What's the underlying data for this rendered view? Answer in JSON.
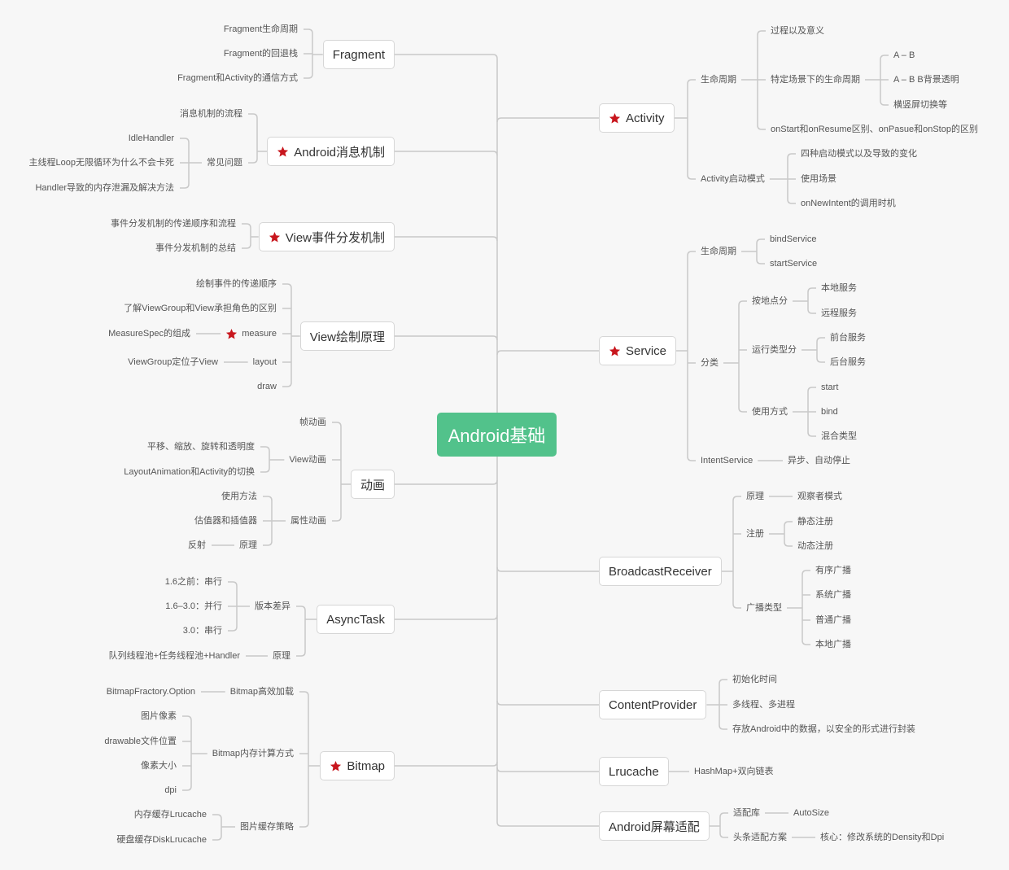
{
  "theme": {
    "background": "#f7f7f7",
    "root_fill": "#52c28b",
    "root_text": "#ffffff",
    "node_border": "#d6d6d6",
    "line": "#c9c9c9",
    "star": "#c8161d",
    "text": "#555555"
  },
  "root": {
    "label": "Android基础"
  },
  "left": [
    {
      "label": "Fragment",
      "starred": false,
      "children": [
        {
          "label": "Fragment生命周期"
        },
        {
          "label": "Fragment的回退栈"
        },
        {
          "label": "Fragment和Activity的通信方式"
        }
      ]
    },
    {
      "label": "Android消息机制",
      "starred": true,
      "children": [
        {
          "label": "消息机制的流程"
        },
        {
          "label": "常见问题",
          "children": [
            {
              "label": "IdleHandler"
            },
            {
              "label": "主线程Loop无限循环为什么不会卡死"
            },
            {
              "label": "Handler导致的内存泄漏及解决方法"
            }
          ]
        }
      ]
    },
    {
      "label": "View事件分发机制",
      "starred": true,
      "children": [
        {
          "label": "事件分发机制的传递顺序和流程"
        },
        {
          "label": "事件分发机制的总结"
        }
      ]
    },
    {
      "label": "View绘制原理",
      "starred": false,
      "children": [
        {
          "label": "绘制事件的传递顺序"
        },
        {
          "label": "了解ViewGroup和View承担角色的区别"
        },
        {
          "label": "measure",
          "starred": true,
          "children": [
            {
              "label": "MeasureSpec的组成"
            }
          ]
        },
        {
          "label": "layout",
          "children": [
            {
              "label": "ViewGroup定位子View"
            }
          ]
        },
        {
          "label": "draw"
        }
      ]
    },
    {
      "label": "动画",
      "starred": false,
      "children": [
        {
          "label": "帧动画"
        },
        {
          "label": "View动画",
          "children": [
            {
              "label": "平移、缩放、旋转和透明度"
            },
            {
              "label": "LayoutAnimation和Activity的切换"
            }
          ]
        },
        {
          "label": "属性动画",
          "children": [
            {
              "label": "使用方法"
            },
            {
              "label": "估值器和插值器"
            },
            {
              "label": "原理",
              "children": [
                {
                  "label": "反射"
                }
              ]
            }
          ]
        }
      ]
    },
    {
      "label": "AsyncTask",
      "starred": false,
      "children": [
        {
          "label": "版本差异",
          "children": [
            {
              "label": "1.6之前：串行"
            },
            {
              "label": "1.6–3.0：并行"
            },
            {
              "label": "3.0：串行"
            }
          ]
        },
        {
          "label": "原理",
          "children": [
            {
              "label": "队列线程池+任务线程池+Handler"
            }
          ]
        }
      ]
    },
    {
      "label": "Bitmap",
      "starred": true,
      "children": [
        {
          "label": "Bitmap高效加载",
          "children": [
            {
              "label": "BitmapFractory.Option"
            }
          ]
        },
        {
          "label": "Bitmap内存计算方式",
          "children": [
            {
              "label": "图片像素"
            },
            {
              "label": "drawable文件位置"
            },
            {
              "label": "像素大小"
            },
            {
              "label": "dpi"
            }
          ]
        },
        {
          "label": "图片缓存策略",
          "children": [
            {
              "label": "内存缓存Lrucache"
            },
            {
              "label": "硬盘缓存DiskLrucache"
            }
          ]
        }
      ]
    }
  ],
  "right": [
    {
      "label": "Activity",
      "starred": true,
      "children": [
        {
          "label": "生命周期",
          "children": [
            {
              "label": "过程以及意义"
            },
            {
              "label": "特定场景下的生命周期",
              "children": [
                {
                  "label": "A – B"
                },
                {
                  "label": "A – B B背景透明"
                },
                {
                  "label": "横竖屏切换等"
                }
              ]
            },
            {
              "label": "onStart和onResume区别、onPasue和onStop的区别"
            }
          ]
        },
        {
          "label": "Activity启动模式",
          "children": [
            {
              "label": "四种启动模式以及导致的变化"
            },
            {
              "label": "使用场景"
            },
            {
              "label": "onNewIntent的调用时机"
            }
          ]
        }
      ]
    },
    {
      "label": "Service",
      "starred": true,
      "children": [
        {
          "label": "生命周期",
          "children": [
            {
              "label": "bindService"
            },
            {
              "label": "startService"
            }
          ]
        },
        {
          "label": "分类",
          "children": [
            {
              "label": "按地点分",
              "children": [
                {
                  "label": "本地服务"
                },
                {
                  "label": "远程服务"
                }
              ]
            },
            {
              "label": "运行类型分",
              "children": [
                {
                  "label": "前台服务"
                },
                {
                  "label": "后台服务"
                }
              ]
            },
            {
              "label": "使用方式",
              "children": [
                {
                  "label": "start"
                },
                {
                  "label": "bind"
                },
                {
                  "label": "混合类型"
                }
              ]
            }
          ]
        },
        {
          "label": "IntentService",
          "children": [
            {
              "label": "异步、自动停止"
            }
          ]
        }
      ]
    },
    {
      "label": "BroadcastReceiver",
      "starred": false,
      "children": [
        {
          "label": "原理",
          "children": [
            {
              "label": "观察者模式"
            }
          ]
        },
        {
          "label": "注册",
          "children": [
            {
              "label": "静态注册"
            },
            {
              "label": "动态注册"
            }
          ]
        },
        {
          "label": "广播类型",
          "children": [
            {
              "label": "有序广播"
            },
            {
              "label": "系统广播"
            },
            {
              "label": "普通广播"
            },
            {
              "label": "本地广播"
            }
          ]
        }
      ]
    },
    {
      "label": "ContentProvider",
      "starred": false,
      "children": [
        {
          "label": "初始化时间"
        },
        {
          "label": "多线程、多进程"
        },
        {
          "label": "存放Android中的数据，以安全的形式进行封装"
        }
      ]
    },
    {
      "label": "Lrucache",
      "starred": false,
      "children": [
        {
          "label": "HashMap+双向链表"
        }
      ]
    },
    {
      "label": "Android屏幕适配",
      "starred": false,
      "children": [
        {
          "label": "适配库",
          "children": [
            {
              "label": "AutoSize"
            }
          ]
        },
        {
          "label": "头条适配方案",
          "children": [
            {
              "label": "核心：修改系统的Density和Dpi"
            }
          ]
        }
      ]
    }
  ]
}
